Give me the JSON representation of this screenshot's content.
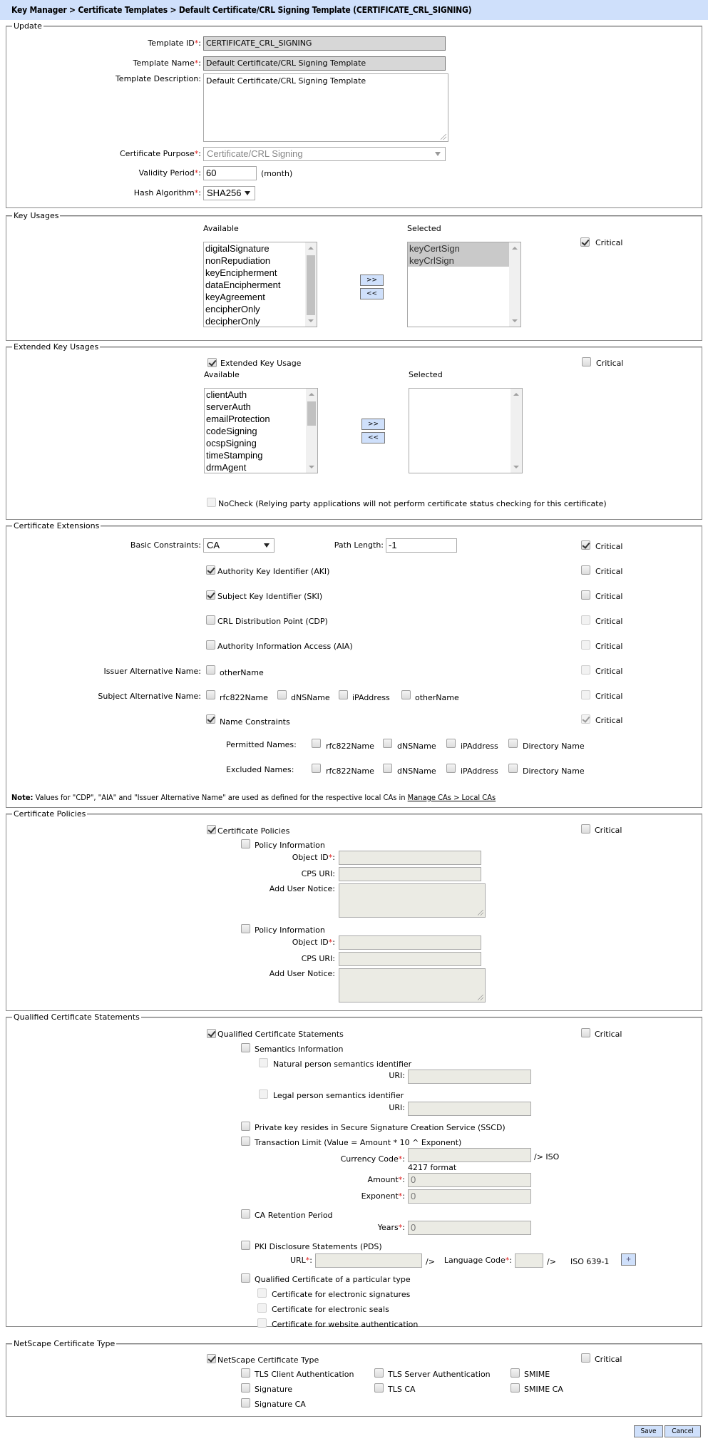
{
  "breadcrumb": "Key Manager > Certificate Templates > Default Certificate/CRL Signing Template (CERTIFICATE_CRL_SIGNING)",
  "update": {
    "legend": "Update",
    "template_id_label": "Template ID",
    "template_id_value": "CERTIFICATE_CRL_SIGNING",
    "template_name_label": "Template Name",
    "template_name_value": "Default Certificate/CRL Signing Template",
    "template_description_label": "Template Description:",
    "template_description_value": "Default Certificate/CRL Signing Template",
    "certificate_purpose_label": "Certificate Purpose",
    "certificate_purpose_value": "Certificate/CRL Signing",
    "validity_period_label": "Validity Period",
    "validity_period_value": "60",
    "validity_unit": "(month)",
    "hash_algorithm_label": "Hash Algorithm",
    "hash_algorithm_value": "SHA256",
    "required_mark": "*",
    "colon": ":"
  },
  "key_usages": {
    "legend": "Key Usages",
    "available_label": "Available",
    "selected_label": "Selected",
    "available": [
      "digitalSignature",
      "nonRepudiation",
      "keyEncipherment",
      "dataEncipherment",
      "keyAgreement",
      "encipherOnly",
      "decipherOnly"
    ],
    "selected": [
      "keyCertSign",
      "keyCrlSign"
    ],
    "add_button": ">>",
    "remove_button": "<<",
    "critical_label": "Critical",
    "critical_checked": true
  },
  "extended_key_usages": {
    "legend": "Extended Key Usages",
    "enable_label": "Extended Key Usage",
    "enable_checked": true,
    "critical_label": "Critical",
    "critical_checked": false,
    "available_label": "Available",
    "selected_label": "Selected",
    "available": [
      "clientAuth",
      "serverAuth",
      "emailProtection",
      "codeSigning",
      "ocspSigning",
      "timeStamping",
      "drmAgent"
    ],
    "selected": [],
    "add_button": ">>",
    "remove_button": "<<",
    "nocheck_label": "NoCheck (Relying party applications will not perform certificate status checking for this certificate)",
    "nocheck_checked": false
  },
  "certificate_extensions": {
    "legend": "Certificate Extensions",
    "basic_constraints_label": "Basic Constraints:",
    "basic_constraints_value": "CA",
    "path_length_label": "Path Length:",
    "path_length_value": "-1",
    "critical_label": "Critical",
    "aki_label": "Authority Key Identifier (AKI)",
    "ski_label": "Subject Key Identifier (SKI)",
    "cdp_label": "CRL Distribution Point (CDP)",
    "aia_label": "Authority Information Access (AIA)",
    "issuer_alt_name_label": "Issuer Alternative Name:",
    "issuer_alt_name_options": [
      "otherName"
    ],
    "subject_alt_name_label": "Subject Alternative Name:",
    "subject_alt_name_options": [
      "rfc822Name",
      "dNSName",
      "iPAddress",
      "otherName"
    ],
    "name_constraints_label": "Name Constraints",
    "permitted_names_label": "Permitted Names:",
    "excluded_names_label": "Excluded Names:",
    "name_options": [
      "rfc822Name",
      "dNSName",
      "iPAddress",
      "Directory Name"
    ],
    "note_prefix": "Note:",
    "note_text": " Values for \"CDP\", \"AIA\" and \"Issuer Alternative Name\" are used as defined for the respective local CAs in ",
    "note_link": "Manage CAs > Local CAs"
  },
  "certificate_policies": {
    "legend": "Certificate Policies",
    "enable_label": "Certificate Policies",
    "critical_label": "Critical",
    "policy_information_label": "Policy Information",
    "object_id_label": "Object ID",
    "cps_uri_label": "CPS URI:",
    "user_notice_label": "Add User Notice:"
  },
  "qualified_statements": {
    "legend": "Qualified Certificate Statements",
    "enable_label": "Qualified Certificate Statements",
    "critical_label": "Critical",
    "semantics_label": "Semantics Information",
    "natural_person_label": "Natural person semantics identifier",
    "legal_person_label": "Legal person semantics identifier",
    "uri_label": "URI:",
    "sscd_label": "Private key resides in Secure Signature Creation Service (SSCD)",
    "transaction_limit_label": "Transaction Limit (Value = Amount * 10 ^ Exponent)",
    "currency_code_label": "Currency Code",
    "currency_suffix": "/> ISO",
    "currency_format": "4217 format",
    "amount_label": "Amount",
    "amount_value": "0",
    "exponent_label": "Exponent",
    "exponent_value": "0",
    "retention_label": "CA Retention Period",
    "years_label": "Years",
    "years_value": "0",
    "pds_label": "PKI Disclosure Statements (PDS)",
    "url_label": "URL",
    "slash": "/>",
    "language_code_label": "Language Code",
    "iso_label": "ISO 639-1",
    "add_button": "+",
    "particular_type_label": "Qualified Certificate of a particular type",
    "esign_label": "Certificate for electronic signatures",
    "eseal_label": "Certificate for electronic seals",
    "web_label": "Certificate for website authentication"
  },
  "netscape": {
    "legend": "NetScape Certificate Type",
    "enable_label": "NetScape Certificate Type",
    "critical_label": "Critical",
    "options": [
      "TLS Client Authentication",
      "TLS Server Authentication",
      "SMIME",
      "Signature",
      "TLS CA",
      "SMIME CA",
      "Signature CA"
    ]
  },
  "footer": {
    "save": "Save",
    "cancel": "Cancel"
  }
}
